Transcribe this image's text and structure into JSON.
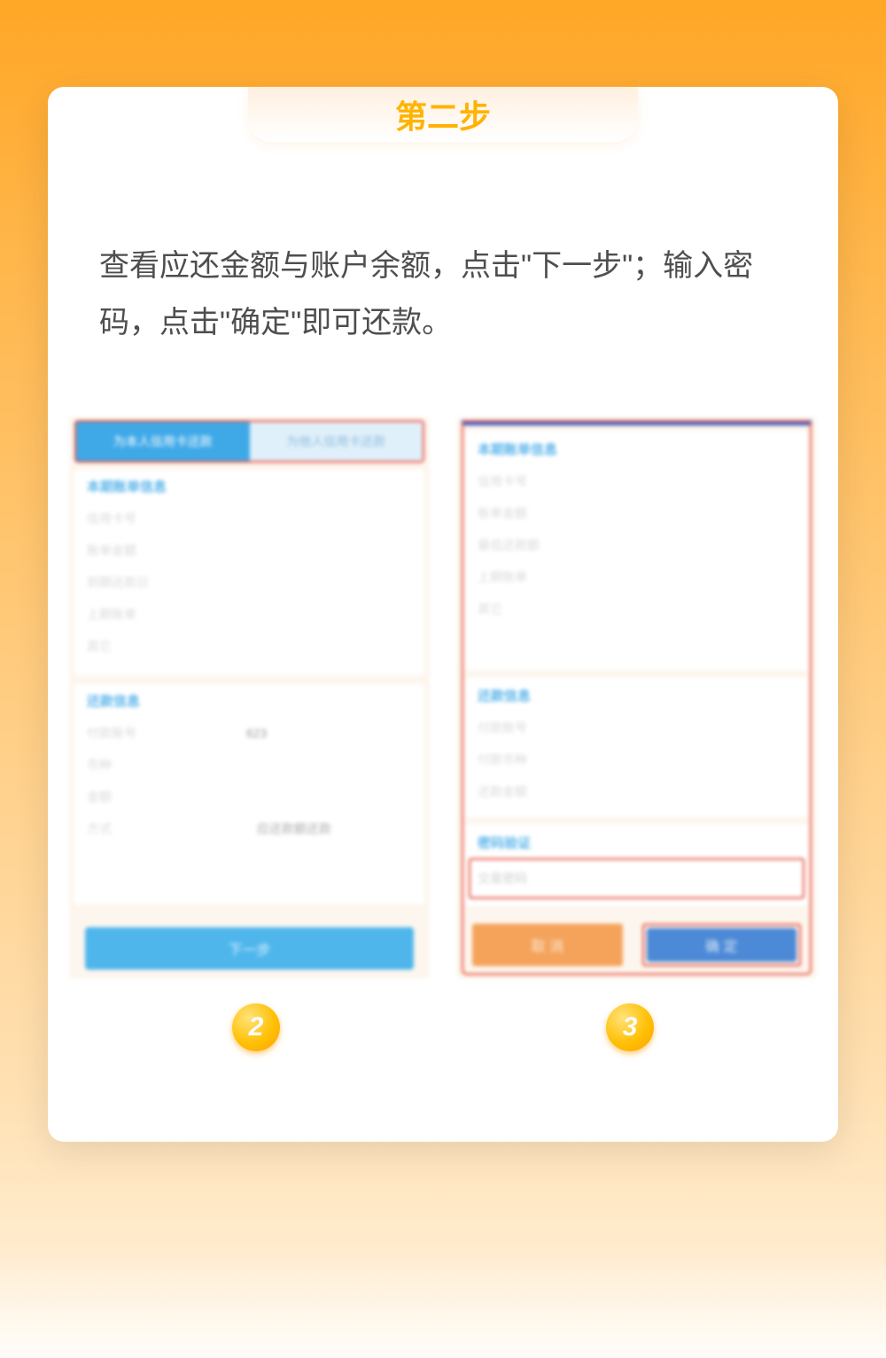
{
  "step_title": "第二步",
  "instruction": "查看应还金额与账户余额，点击\"下一步\"；输入密码，点击\"确定\"即可还款。",
  "left": {
    "tab_active": "为本人信用卡还款",
    "tab_inactive": "为他人信用卡还款",
    "panel1_title": "本期账单信息",
    "panel1_lines": [
      "信用卡号",
      "账单金额",
      "到期还款日",
      "上期账单",
      "其它"
    ],
    "panel2_title": "还款信息",
    "panel2_card_label": "付款账号",
    "panel2_card_value": "623",
    "panel2_line2": "币种",
    "panel2_line3": "金额",
    "panel2_line4_label": "方式",
    "panel2_line4_value": "应还款额还款",
    "button": "下一步"
  },
  "right": {
    "panel1_title": "本期账单信息",
    "panel1_lines": [
      "信用卡号",
      "账单金额",
      "最低还款额",
      "上期账单",
      "其它"
    ],
    "panel2_title": "还款信息",
    "panel2_lines": [
      "付款账号",
      "付款币种",
      "还款金额"
    ],
    "panel3_title": "密码验证",
    "input_placeholder": "交易密码",
    "cancel": "取 消",
    "confirm": "确 定"
  },
  "badges": {
    "left": "2",
    "right": "3"
  }
}
